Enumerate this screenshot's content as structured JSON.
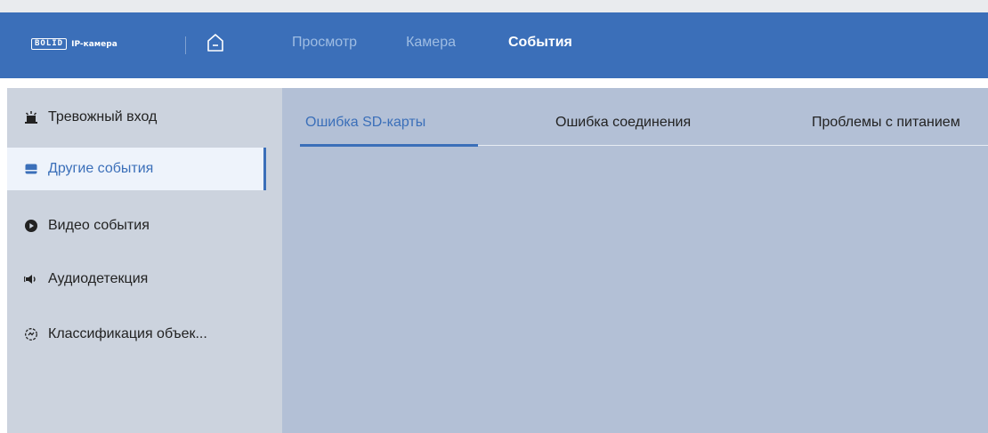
{
  "header": {
    "logo": {
      "brand": "BOLID",
      "product": "IP-камера"
    },
    "home_icon": "home-icon",
    "nav": [
      {
        "label": "Просмотр",
        "active": false
      },
      {
        "label": "Камера",
        "active": false
      },
      {
        "label": "События",
        "active": true
      }
    ]
  },
  "sidebar": {
    "items": [
      {
        "label": "Тревожный вход",
        "icon": "alarm-input-icon",
        "active": false
      },
      {
        "label": "Другие события",
        "icon": "other-events-icon",
        "active": true
      },
      {
        "label": "Видео события",
        "icon": "video-events-icon",
        "active": false
      },
      {
        "label": "Аудиодетекция",
        "icon": "audio-detection-icon",
        "active": false
      },
      {
        "label": "Классификация объек...",
        "icon": "object-classification-icon",
        "active": false
      }
    ]
  },
  "main": {
    "tabs": [
      {
        "label": "Ошибка SD-карты",
        "active": true
      },
      {
        "label": "Ошибка соединения",
        "active": false
      },
      {
        "label": "Проблемы с питанием",
        "active": false
      }
    ]
  },
  "colors": {
    "header": "#3b6fb9",
    "accent": "#3b6fb9",
    "sidebar_bg": "#ccd3de",
    "main_bg": "#b3c0d6",
    "active_item_bg": "#eef3fb"
  }
}
